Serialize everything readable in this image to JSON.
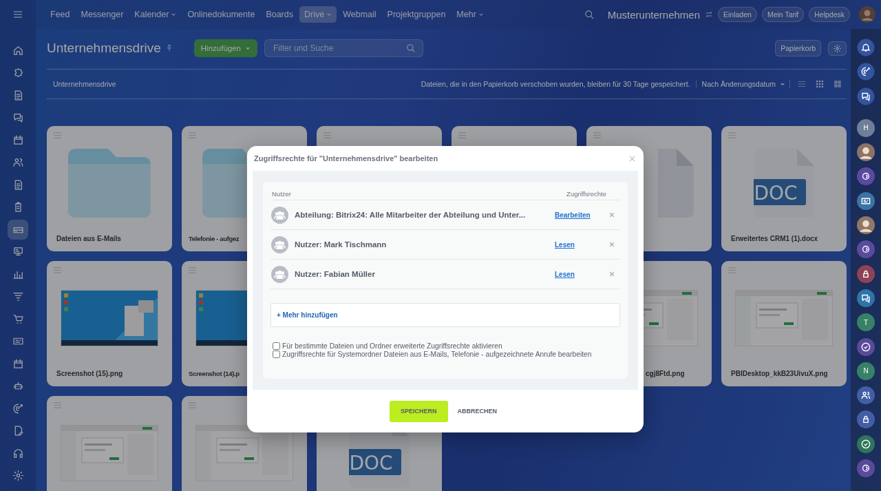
{
  "topnav": {
    "items": [
      {
        "label": "Feed",
        "selected": false,
        "dropdown": false
      },
      {
        "label": "Messenger",
        "selected": false,
        "dropdown": false
      },
      {
        "label": "Kalender",
        "selected": false,
        "dropdown": true
      },
      {
        "label": "Onlinedokumente",
        "selected": false,
        "dropdown": false
      },
      {
        "label": "Boards",
        "selected": false,
        "dropdown": false
      },
      {
        "label": "Drive",
        "selected": true,
        "dropdown": true
      },
      {
        "label": "Webmail",
        "selected": false,
        "dropdown": false
      },
      {
        "label": "Projektgruppen",
        "selected": false,
        "dropdown": false
      },
      {
        "label": "Mehr",
        "selected": false,
        "dropdown": true
      }
    ],
    "company": "Musterunternehmen",
    "buttons": [
      "Einladen",
      "Mein Tarif",
      "Helpdesk"
    ]
  },
  "sidebar": {
    "items": [
      {
        "kind": "home",
        "selected": false
      },
      {
        "kind": "puzzle",
        "selected": false
      },
      {
        "kind": "doc",
        "selected": false
      },
      {
        "kind": "chat",
        "selected": false
      },
      {
        "kind": "calendar",
        "selected": false
      },
      {
        "kind": "people",
        "selected": false
      },
      {
        "kind": "doc",
        "selected": false
      },
      {
        "kind": "tasks",
        "selected": false
      },
      {
        "kind": "drive",
        "selected": true
      },
      {
        "kind": "board",
        "selected": false
      },
      {
        "kind": "chart",
        "selected": false
      },
      {
        "kind": "filter",
        "selected": false
      },
      {
        "kind": "cart",
        "selected": false
      },
      {
        "kind": "card",
        "selected": false
      },
      {
        "kind": "calendar",
        "selected": false
      },
      {
        "kind": "robot",
        "selected": false
      },
      {
        "kind": "target",
        "selected": false
      },
      {
        "kind": "edit",
        "selected": false
      },
      {
        "kind": "headset",
        "selected": false
      },
      {
        "kind": "gear",
        "selected": false
      }
    ]
  },
  "page": {
    "title": "Unternehmensdrive",
    "add_button": "Hinzufügen",
    "search": {
      "placeholder": "Filter und Suche"
    },
    "trash_button": "Papierkorb",
    "breadcrumb": "Unternehmensdrive",
    "notice": "Dateien, die in den Papierkorb verschoben wurden, bleiben für 30 Tage gespeichert.",
    "sort": "Nach Änderungsdatum",
    "views": [
      {
        "kind": "list",
        "selected": false
      },
      {
        "kind": "grid",
        "selected": true
      },
      {
        "kind": "tiles",
        "selected": false
      }
    ]
  },
  "cards": [
    {
      "kind": "folder",
      "label": "Dateien aus E-Mails"
    },
    {
      "kind": "folder",
      "label": "Telefonie - aufgez"
    },
    {
      "kind": "empty"
    },
    {
      "kind": "empty"
    },
    {
      "kind": "file"
    },
    {
      "kind": "doc",
      "badge": "DOC",
      "label": "Erweitertes CRM1 (1).docx"
    },
    {
      "kind": "desktop",
      "label": "Screenshot (15).png"
    },
    {
      "kind": "desktop",
      "label": "Screenshot (14).p"
    },
    {
      "kind": "sheet",
      "label": "cgj8Ftd.png"
    },
    {
      "kind": "sheet",
      "label": "PBIDesktop_kkB23UivuX.png"
    },
    {
      "kind": "sheet"
    },
    {
      "kind": "sheet"
    },
    {
      "kind": "doc",
      "badge": "DOC"
    }
  ],
  "right_bar": [
    {
      "kind": "bell"
    },
    {
      "kind": "target"
    },
    {
      "kind": "chat"
    },
    {
      "kind": "letter",
      "text": "H",
      "color": "#6f7f99"
    },
    {
      "kind": "avatar",
      "color": "#8a7466"
    },
    {
      "kind": "round",
      "color": "#5a4a9e"
    },
    {
      "kind": "card",
      "color": "#3c73a6"
    },
    {
      "kind": "avatar",
      "color": "#907868"
    },
    {
      "kind": "round",
      "color": "#5a4a9e"
    },
    {
      "kind": "lock",
      "color": "#8e4354"
    },
    {
      "kind": "chat",
      "color": "#2e74aa"
    },
    {
      "kind": "letter",
      "text": "T",
      "color": "#378266"
    },
    {
      "kind": "check",
      "color": "#5a4a99"
    },
    {
      "kind": "letter",
      "text": "N",
      "color": "#378266"
    },
    {
      "kind": "people",
      "color": "#435ea6"
    },
    {
      "kind": "lock",
      "color": "#435ea6"
    },
    {
      "kind": "check",
      "color": "#2d755b"
    },
    {
      "kind": "round",
      "color": "#5a4a9e"
    }
  ],
  "dialog": {
    "title": "Zugriffsrechte für \"Unternehmensdrive\" bearbeiten",
    "columns": [
      "Nutzer",
      "Zugriffsrechte"
    ],
    "rows": [
      {
        "name": "Abteilung: Bitrix24: Alle Mitarbeiter der Abteilung und Unter...",
        "right": "Bearbeiten"
      },
      {
        "name": "Nutzer: Mark Tischmann",
        "right": "Lesen"
      },
      {
        "name": "Nutzer: Fabian Müller",
        "right": "Lesen"
      }
    ],
    "add_more": "+ Mehr hinzufügen",
    "options": [
      {
        "label": "Für bestimmte Dateien und Ordner erweiterte Zugriffsrechte aktivieren",
        "checked": false
      },
      {
        "label": "Zugriffsrechte für Systemordner Dateien aus E-Mails, Telefonie - aufgezeichnete Anrufe bearbeiten",
        "checked": false
      }
    ],
    "save": "SPEICHERN",
    "cancel": "ABBRECHEN"
  }
}
